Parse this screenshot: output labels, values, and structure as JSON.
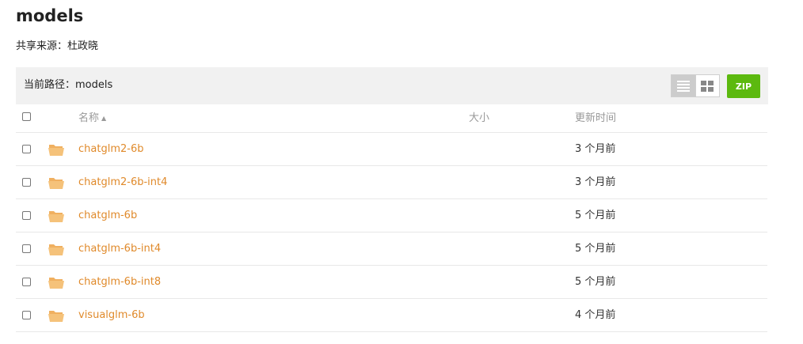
{
  "page": {
    "title": "models",
    "share_label": "共享来源：",
    "share_owner": "杜政晓"
  },
  "pathbar": {
    "label": "当前路径：",
    "path": "models",
    "list_view_icon": "list-icon",
    "grid_view_icon": "grid-icon",
    "zip_label": "ZIP"
  },
  "table": {
    "headers": {
      "name": "名称",
      "sort_icon": "sort-ascending-icon",
      "size": "大小",
      "time": "更新时间"
    },
    "rows": [
      {
        "name": "chatglm2-6b",
        "time": "3 个月前",
        "icon": "folder-open-icon"
      },
      {
        "name": "chatglm2-6b-int4",
        "time": "3 个月前",
        "icon": "folder-open-icon"
      },
      {
        "name": "chatglm-6b",
        "time": "5 个月前",
        "icon": "folder-open-icon"
      },
      {
        "name": "chatglm-6b-int4",
        "time": "5 个月前",
        "icon": "folder-open-icon"
      },
      {
        "name": "chatglm-6b-int8",
        "time": "5 个月前",
        "icon": "folder-open-icon"
      },
      {
        "name": "visualglm-6b",
        "time": "4 个月前",
        "icon": "folder-open-icon"
      }
    ]
  },
  "colors": {
    "link": "#e08a2b",
    "folder": "#f0b060",
    "zip_button": "#5cb90f",
    "pathbar_bg": "#f1f1f1"
  }
}
